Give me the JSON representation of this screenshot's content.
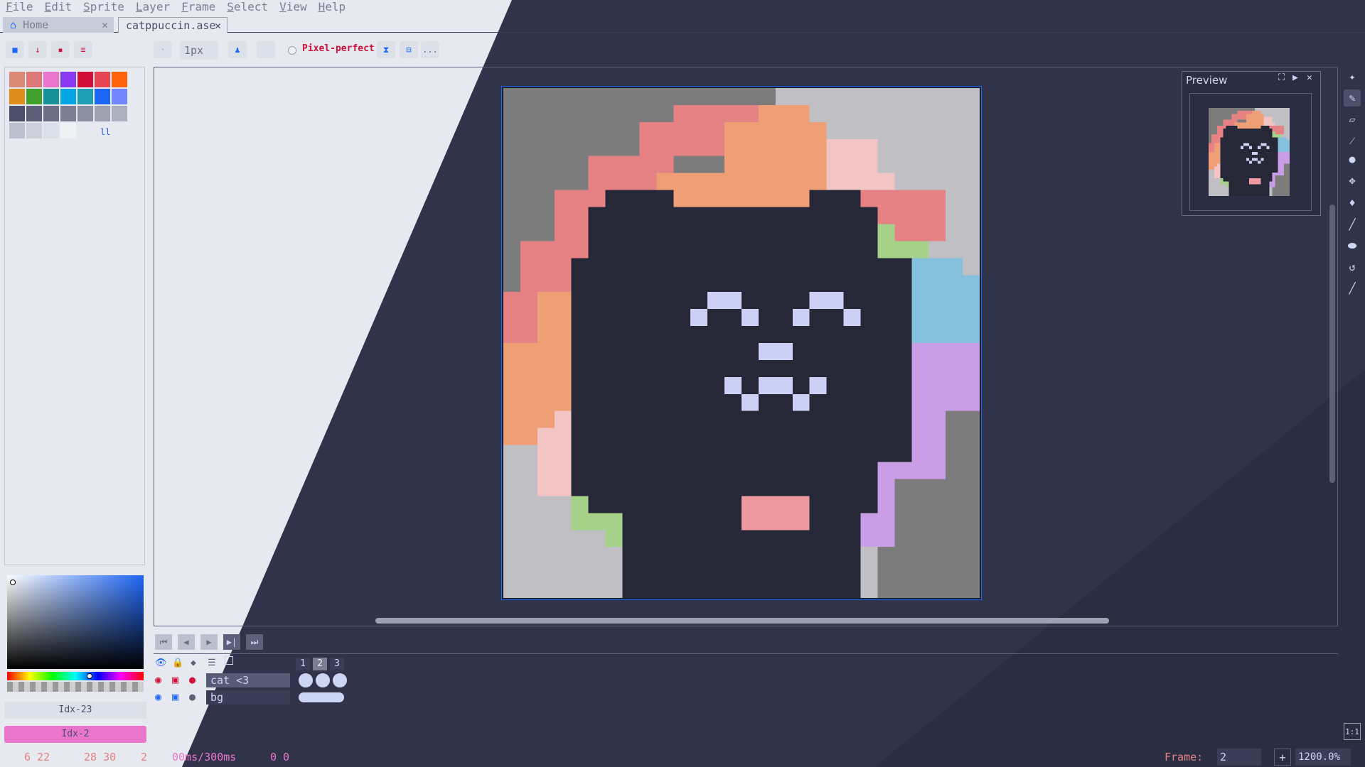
{
  "menu": [
    "File",
    "Edit",
    "Sprite",
    "Layer",
    "Frame",
    "Select",
    "View",
    "Help"
  ],
  "tabs": [
    {
      "label": "Home",
      "close": "✕"
    },
    {
      "label": "catppuccin.ase",
      "close": "✕"
    }
  ],
  "toolbar": {
    "brush_size": "1px",
    "pixel_perfect_label": "Pixel-perfect",
    "more_label": "..."
  },
  "palette": {
    "colors": [
      "#dc8a78",
      "#dd7878",
      "#ea76cb",
      "#8839ef",
      "#d20f39",
      "#e64553",
      "#fe640b",
      "#df8e1d",
      "#40a02b",
      "#179299",
      "#04a5e5",
      "#209fb5",
      "#1e66f5",
      "#7287fd",
      "#4c4f69",
      "#5c5f77",
      "#6c6f85",
      "#7c7f93",
      "#8c8fa1",
      "#9ca0b0",
      "#acb0be",
      "#bcc0cc",
      "#ccd0da",
      "#dce0e8",
      "#eff1f5"
    ]
  },
  "color_indices": {
    "fg": "Idx-23",
    "bg": "Idx-2"
  },
  "preview": {
    "title": "Preview"
  },
  "timeline": {
    "frames": [
      "1",
      "2",
      "3"
    ],
    "layers": [
      {
        "name": "cat <3"
      },
      {
        "name": "bg"
      }
    ]
  },
  "status": {
    "pos1": "6 22",
    "pos2": "28 30",
    "pos3": "2",
    "timing": "00ms/300ms",
    "extra": "0 0",
    "frame_label": "Frame:",
    "frame_value": "2",
    "zoom_value": "1200.0%",
    "plus": "+"
  },
  "art": {
    "bg_dark": "#7c7c7c",
    "bg_light": "#c0c0c4",
    "cat": "#262838",
    "eyes": "#ccd0f4",
    "mouth": "#ee99a0",
    "rainbow": [
      "#e78284",
      "#ef9f76",
      "#f2c4c4",
      "#a6d189",
      "#85c1dc",
      "#ca9ee6"
    ]
  }
}
